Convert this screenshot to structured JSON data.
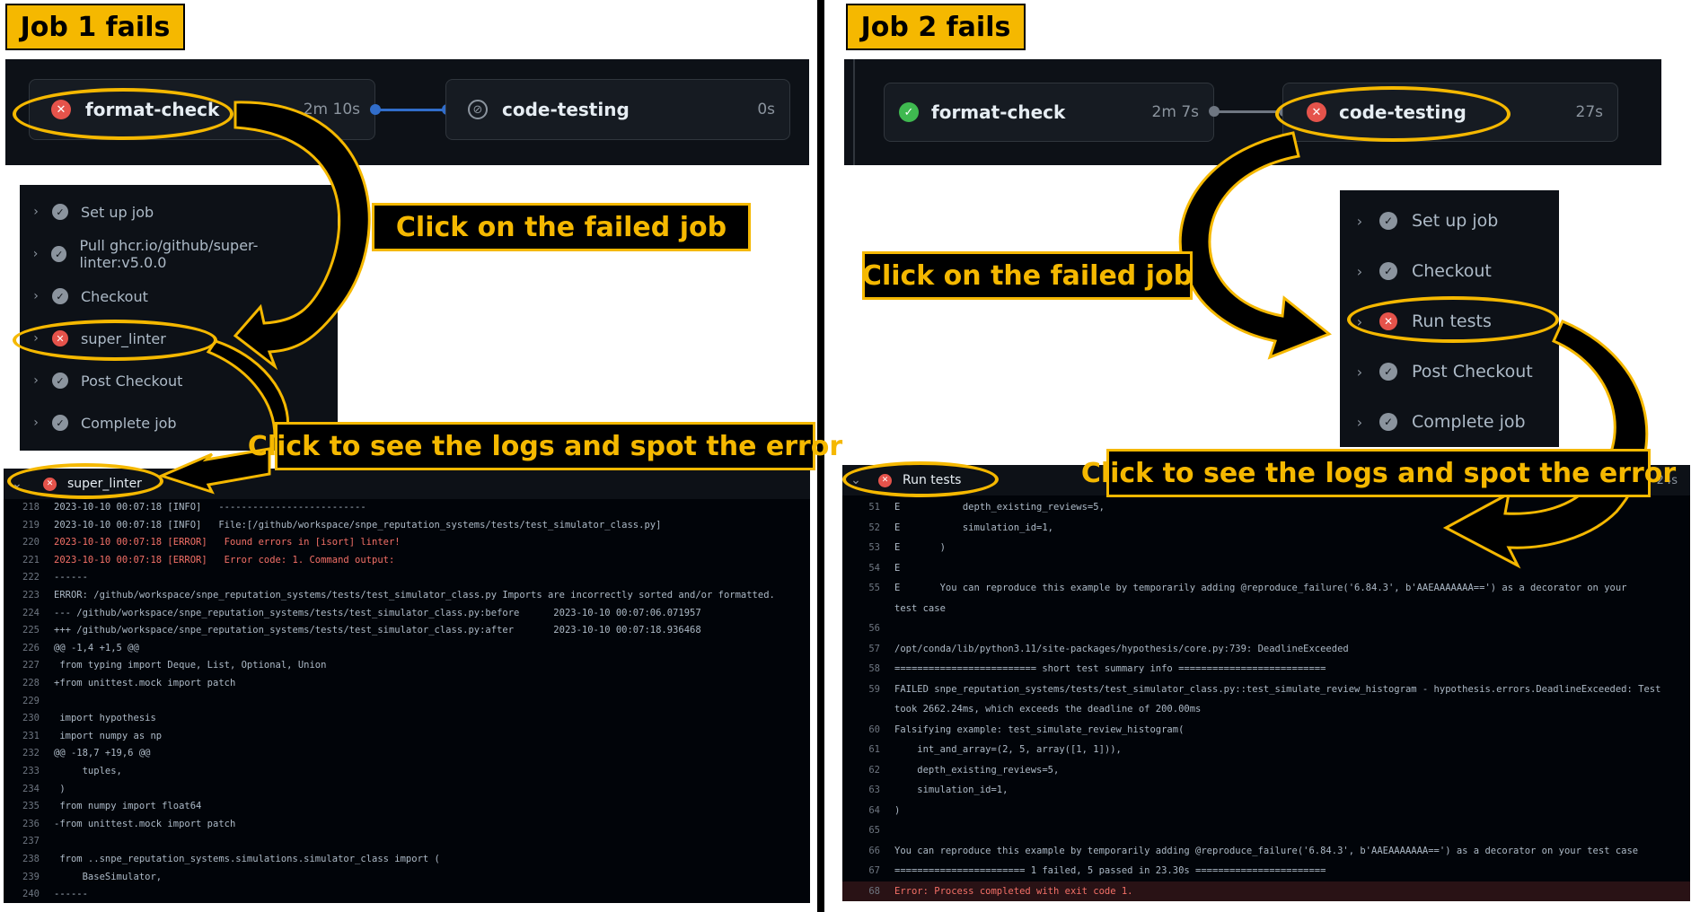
{
  "left": {
    "header": "Job 1 fails",
    "jobs": [
      {
        "name": "format-check",
        "status": "failed",
        "time": "2m 10s"
      },
      {
        "name": "code-testing",
        "status": "skipped",
        "time": "0s"
      }
    ],
    "callout_click_job": "Click on the failed job",
    "callout_logs": "Click to see the logs and spot the error",
    "steps": [
      {
        "label": "Set up job",
        "status": "success"
      },
      {
        "label": "Pull ghcr.io/github/super-linter:v5.0.0",
        "status": "success"
      },
      {
        "label": "Checkout",
        "status": "success"
      },
      {
        "label": "super_linter",
        "status": "failed"
      },
      {
        "label": "Post Checkout",
        "status": "success"
      },
      {
        "label": "Complete job",
        "status": "success"
      }
    ],
    "log_title": "super_linter",
    "log_lines": [
      {
        "n": "218",
        "t": "2023-10-10 00:07:18 [INFO]   --------------------------"
      },
      {
        "n": "219",
        "t": "2023-10-10 00:07:18 [INFO]   File:[/github/workspace/snpe_reputation_systems/tests/test_simulator_class.py]"
      },
      {
        "n": "220",
        "t": "2023-10-10 00:07:18 [ERROR]   Found errors in [isort] linter!"
      },
      {
        "n": "221",
        "t": "2023-10-10 00:07:18 [ERROR]   Error code: 1. Command output:"
      },
      {
        "n": "222",
        "t": "------"
      },
      {
        "n": "223",
        "t": "ERROR: /github/workspace/snpe_reputation_systems/tests/test_simulator_class.py Imports are incorrectly sorted and/or formatted."
      },
      {
        "n": "224",
        "t": "--- /github/workspace/snpe_reputation_systems/tests/test_simulator_class.py:before      2023-10-10 00:07:06.071957"
      },
      {
        "n": "225",
        "t": "+++ /github/workspace/snpe_reputation_systems/tests/test_simulator_class.py:after       2023-10-10 00:07:18.936468"
      },
      {
        "n": "226",
        "t": "@@ -1,4 +1,5 @@"
      },
      {
        "n": "227",
        "t": " from typing import Deque, List, Optional, Union"
      },
      {
        "n": "228",
        "t": "+from unittest.mock import patch"
      },
      {
        "n": "229",
        "t": ""
      },
      {
        "n": "230",
        "t": " import hypothesis"
      },
      {
        "n": "231",
        "t": " import numpy as np"
      },
      {
        "n": "232",
        "t": "@@ -18,7 +19,6 @@"
      },
      {
        "n": "233",
        "t": "     tuples,"
      },
      {
        "n": "234",
        "t": " )"
      },
      {
        "n": "235",
        "t": " from numpy import float64"
      },
      {
        "n": "236",
        "t": "-from unittest.mock import patch"
      },
      {
        "n": "237",
        "t": ""
      },
      {
        "n": "238",
        "t": " from ..snpe_reputation_systems.simulations.simulator_class import ("
      },
      {
        "n": "239",
        "t": "     BaseSimulator,"
      },
      {
        "n": "240",
        "t": "------"
      }
    ]
  },
  "right": {
    "header": "Job 2 fails",
    "jobs": [
      {
        "name": "format-check",
        "status": "success",
        "time": "2m 7s"
      },
      {
        "name": "code-testing",
        "status": "failed",
        "time": "27s"
      }
    ],
    "callout_click_job": "Click on the failed job",
    "callout_logs": "Click to see the logs and spot the error",
    "steps": [
      {
        "label": "Set up job",
        "status": "success"
      },
      {
        "label": "Checkout",
        "status": "success"
      },
      {
        "label": "Run tests",
        "status": "failed"
      },
      {
        "label": "Post Checkout",
        "status": "success"
      },
      {
        "label": "Complete job",
        "status": "success"
      }
    ],
    "log_title": "Run tests",
    "log_time": "24s",
    "log_lines": [
      {
        "n": "51",
        "t": "E           depth_existing_reviews=5,"
      },
      {
        "n": "52",
        "t": "E           simulation_id=1,"
      },
      {
        "n": "53",
        "t": "E       )"
      },
      {
        "n": "54",
        "t": "E"
      },
      {
        "n": "55",
        "t": "E       You can reproduce this example by temporarily adding @reproduce_failure('6.84.3', b'AAEAAAAAAA==') as a decorator on your"
      },
      {
        "n": "",
        "t": "test case"
      },
      {
        "n": "56",
        "t": ""
      },
      {
        "n": "57",
        "t": "/opt/conda/lib/python3.11/site-packages/hypothesis/core.py:739: DeadlineExceeded"
      },
      {
        "n": "58",
        "t": "========================= short test summary info =========================="
      },
      {
        "n": "59",
        "t": "FAILED snpe_reputation_systems/tests/test_simulator_class.py::test_simulate_review_histogram - hypothesis.errors.DeadlineExceeded: Test"
      },
      {
        "n": "",
        "t": "took 2662.24ms, which exceeds the deadline of 200.00ms"
      },
      {
        "n": "60",
        "t": "Falsifying example: test_simulate_review_histogram("
      },
      {
        "n": "61",
        "t": "    int_and_array=(2, 5, array([1, 1])),"
      },
      {
        "n": "62",
        "t": "    depth_existing_reviews=5,"
      },
      {
        "n": "63",
        "t": "    simulation_id=1,"
      },
      {
        "n": "64",
        "t": ")"
      },
      {
        "n": "65",
        "t": ""
      },
      {
        "n": "66",
        "t": "You can reproduce this example by temporarily adding @reproduce_failure('6.84.3', b'AAEAAAAAAA==') as a decorator on your test case"
      },
      {
        "n": "67",
        "t": "======================= 1 failed, 5 passed in 23.30s ======================="
      },
      {
        "n": "68",
        "t": "Error: Process completed with exit code 1."
      }
    ]
  },
  "colors": {
    "accent": "#f5b800",
    "error": "#e5534b",
    "success": "#3fb950",
    "bg": "#0d1117"
  }
}
